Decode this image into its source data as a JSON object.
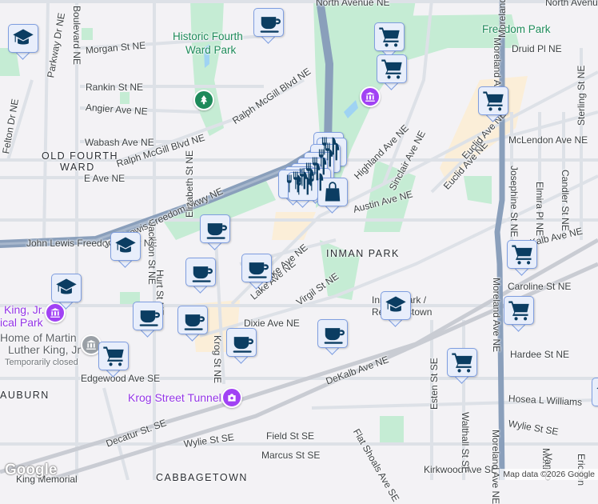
{
  "labels": [
    "North Avenue NE",
    "North Avenue NE",
    "Morgan St NE",
    "Rankin St NE",
    "Angier Ave NE",
    "Wabash Ave NE",
    "OLD FOURTH",
    "WARD",
    "Ralph McGill Blvd NE",
    "Ralph McGill Blvd NE",
    "E Ave NE",
    "John Lewis Freedom Pkwy NE",
    "Historic Fourth",
    "Ward Park",
    "Freedom Park",
    "Druid Pl NE",
    "McLendon Ave NE",
    "Euclid Ave NE",
    "Sinclair Ave NE",
    "Austin Ave NE",
    "Highland Ave NE",
    "DeKalb Ave NE",
    "INMAN PARK",
    "Lake Ave NE",
    "Virgil St NE",
    "Caroline St NE",
    "Hardee St NE",
    "Hosea L Williams",
    "Wylie St SE",
    "Dixie Ave NE",
    "Krog St NE",
    "DeKalb Ave NE",
    "Edgewood Ave SE",
    "AUBURN",
    "Krog Street Tunnel",
    "Decatur St. SE",
    "Wylie St SE",
    "Field St SE",
    "Marcus St SE",
    "CABBAGETOWN",
    "Kirkwood Ave SE",
    "Flat Shoals Ave SE",
    "Esten St SE",
    "Walthall St SE",
    "Moreland Ave NE",
    "Moreland Ave NE",
    "Moreland Ave NE",
    "Josephine St NE",
    "Elmira Pl NE",
    "Candler St NE",
    "Sterling St NE",
    "Felton Dr NE",
    "Parkway Dr NE",
    "Boulevard NE",
    "Home of Martin",
    "Luther King, Jr",
    "Temporarily closed",
    "King, Jr.",
    "ical Park",
    "Inman Park /",
    "Reynoldstown",
    "John Lewis Freedom Pkwy NE",
    "Jackson St NE",
    "Euclid Ave NE",
    "Moreland Ave NE",
    "Morti",
    "Vanno",
    "Ericson",
    "King Memorial",
    "Elizabeth St NE",
    "Hurt St NE",
    "Lake Ave NE"
  ],
  "markers": [
    "school",
    "coffee",
    "shopping-cart",
    "shopping-cart",
    "shopping-cart",
    "restaurant",
    "restaurant",
    "restaurant",
    "restaurant",
    "restaurant",
    "restaurant",
    "restaurant",
    "restaurant",
    "restaurant",
    "restaurant",
    "shopping-bag",
    "coffee",
    "school",
    "coffee",
    "coffee",
    "school",
    "coffee",
    "coffee",
    "coffee",
    "shopping-cart",
    "coffee",
    "school",
    "shopping-cart",
    "shopping-cart",
    "shopping-cart",
    "school"
  ],
  "pins": [
    {
      "type": "park",
      "color": "#1e8a5a"
    },
    {
      "type": "museum",
      "color": "#a142f4"
    },
    {
      "type": "historic-site",
      "color": "#a142f4"
    },
    {
      "type": "museum-closed",
      "color": "#9aa0a6"
    },
    {
      "type": "camera",
      "color": "#a142f4"
    }
  ],
  "attribution": "Map data ©2026 Google",
  "logo": "Google",
  "colors": {
    "marker_icon": "#0b3d62",
    "park": "#c5ecd4",
    "highway": "#8a9fbb",
    "road": "#dde1e7"
  }
}
